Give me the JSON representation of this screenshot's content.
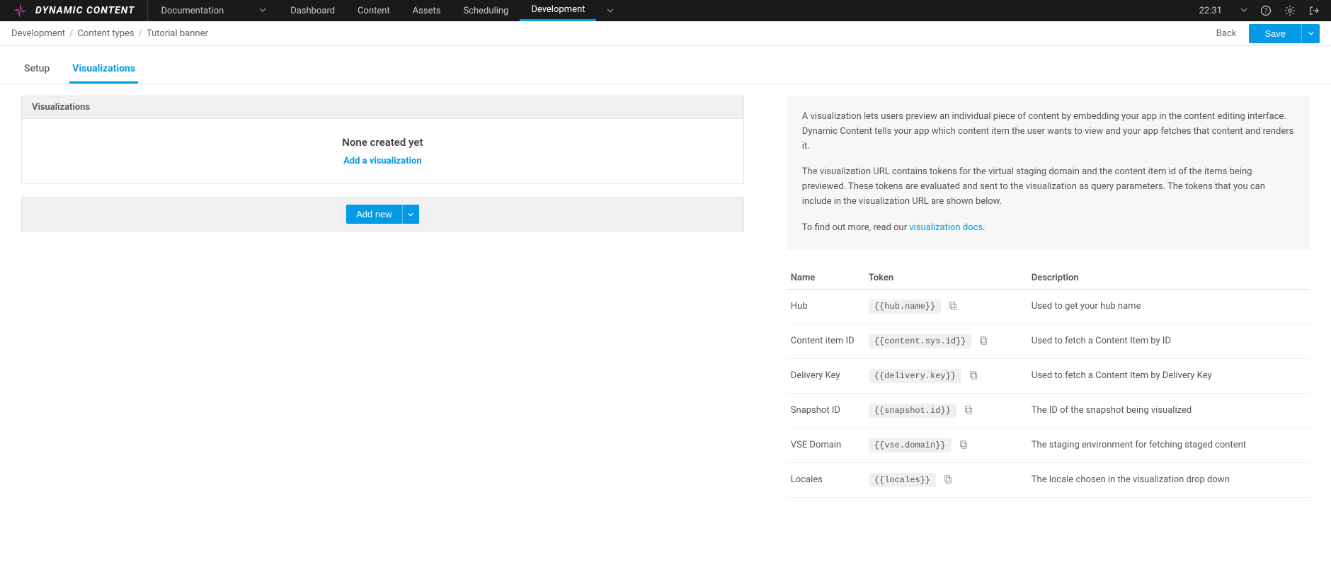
{
  "brand": "DYNAMIC CONTENT",
  "nav_dropdown": {
    "label": "Documentation"
  },
  "nav_tabs": [
    "Dashboard",
    "Content",
    "Assets",
    "Scheduling",
    "Development"
  ],
  "nav_active_index": 4,
  "time": "22:31",
  "breadcrumb": {
    "items": [
      "Development",
      "Content types",
      "Tutorial banner"
    ]
  },
  "back_label": "Back",
  "save_label": "Save",
  "page_tabs": {
    "setup": "Setup",
    "visualizations": "Visualizations"
  },
  "viz_panel": {
    "header": "Visualizations",
    "none_title": "None created yet",
    "add_link": "Add a visualization",
    "add_new": "Add new"
  },
  "info": {
    "p1": "A visualization lets users preview an individual piece of content by embedding your app in the content editing interface. Dynamic Content tells your app which content item the user wants to view and your app fetches that content and renders it.",
    "p2": "The visualization URL contains tokens for the virtual staging domain and the content item id of the items being previewed. These tokens are evaluated and sent to the visualization as query parameters. The tokens that you can include in the visualization URL are shown below.",
    "p3_prefix": "To find out more, read our ",
    "p3_link": "visualization docs",
    "p3_suffix": "."
  },
  "token_table": {
    "headers": {
      "name": "Name",
      "token": "Token",
      "description": "Description"
    },
    "rows": [
      {
        "name": "Hub",
        "token": "{{hub.name}}",
        "desc": "Used to get your hub name"
      },
      {
        "name": "Content item ID",
        "token": "{{content.sys.id}}",
        "desc": "Used to fetch a Content Item by ID"
      },
      {
        "name": "Delivery Key",
        "token": "{{delivery.key}}",
        "desc": "Used to fetch a Content Item by Delivery Key"
      },
      {
        "name": "Snapshot ID",
        "token": "{{snapshot.id}}",
        "desc": "The ID of the snapshot being visualized"
      },
      {
        "name": "VSE Domain",
        "token": "{{vse.domain}}",
        "desc": "The staging environment for fetching staged content"
      },
      {
        "name": "Locales",
        "token": "{{locales}}",
        "desc": "The locale chosen in the visualization drop down"
      }
    ]
  }
}
